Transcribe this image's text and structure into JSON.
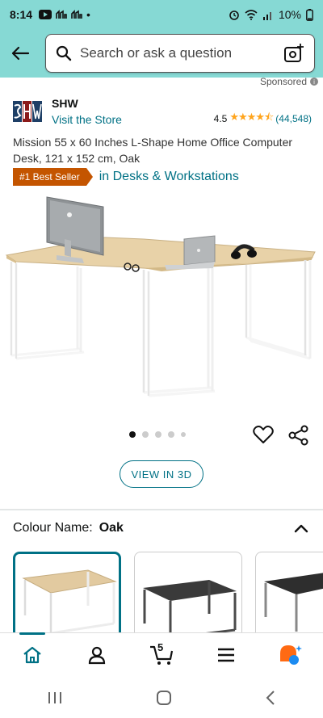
{
  "status": {
    "time": "8:14",
    "battery": "10%",
    "left_icons": [
      "youtube-icon",
      "notification-icon",
      "notification-icon",
      "dot"
    ],
    "right_icons": [
      "alarm-icon",
      "wifi-icon",
      "signal-icon",
      "battery-icon"
    ]
  },
  "search": {
    "placeholder": "Search or ask a question"
  },
  "sponsored": {
    "label": "Sponsored"
  },
  "brand": {
    "name": "SHW",
    "visit_store": "Visit the Store"
  },
  "rating": {
    "value": "4.5",
    "stars": "★★★★⯪",
    "count": "(44,548)"
  },
  "product": {
    "title": "Mission 55 x 60 Inches L-Shape Home Office Computer Desk, 121 x 152 cm, Oak",
    "badge": "#1 Best Seller",
    "badge_category": "in Desks & Workstations",
    "image_count": 5,
    "active_image": 0
  },
  "actions": {
    "view_3d": "VIEW IN 3D"
  },
  "colour": {
    "label": "Colour Name:",
    "value": "Oak"
  },
  "swatches": [
    {
      "name": "Oak",
      "top_color": "#e2caa0",
      "frame_color": "#f4f4f4",
      "selected": true
    },
    {
      "name": "Black",
      "top_color": "#3a3a3a",
      "frame_color": "#4a4a4a",
      "selected": false
    },
    {
      "name": "Black-Grey",
      "top_color": "#2e2e2e",
      "frame_color": "#888",
      "selected": false
    }
  ],
  "bottom_nav": {
    "cart_count": "5",
    "items": [
      "home-icon",
      "account-icon",
      "cart-icon",
      "menu-icon",
      "rufus-icon"
    ]
  },
  "colors": {
    "header": "#86d9d4",
    "link": "#007185",
    "badge": "#c45500",
    "star": "#ffa41c"
  }
}
